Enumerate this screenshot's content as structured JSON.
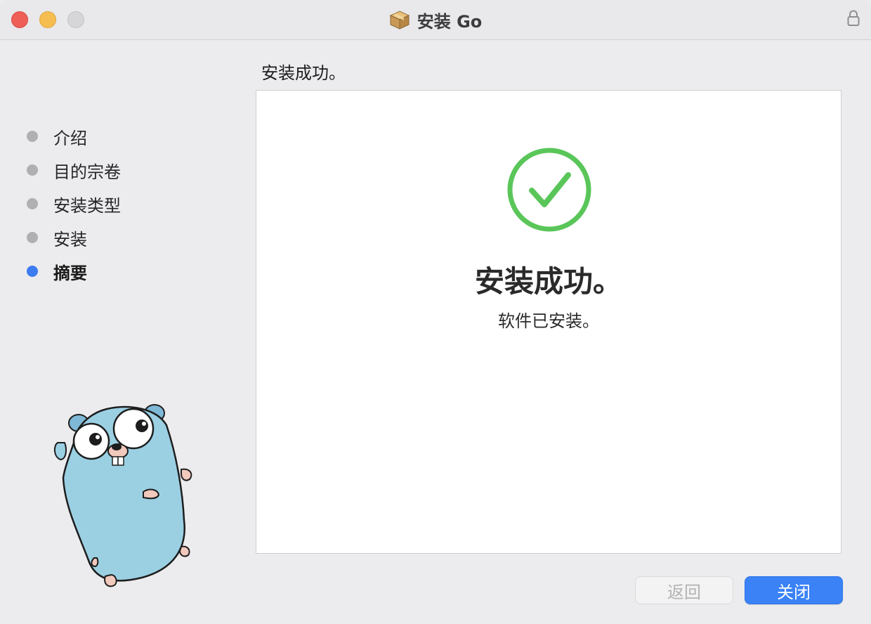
{
  "window": {
    "title": "安装 Go",
    "title_icon": "package-icon",
    "lock_icon": "lock-icon"
  },
  "sidebar": {
    "steps": [
      {
        "label": "介绍",
        "active": false
      },
      {
        "label": "目的宗卷",
        "active": false
      },
      {
        "label": "安装类型",
        "active": false
      },
      {
        "label": "安装",
        "active": false
      },
      {
        "label": "摘要",
        "active": true
      }
    ],
    "active_color": "#3d7cf0",
    "inactive_color": "#b0b0b2"
  },
  "main": {
    "header_status": "安装成功。",
    "success_title": "安装成功。",
    "success_subtitle": "软件已安装。",
    "check_color": "#5ac65a"
  },
  "buttons": {
    "back_label": "返回",
    "close_label": "关闭",
    "back_enabled": false
  },
  "colors": {
    "accent": "#3a82f6",
    "traffic_close": "#ee5f57",
    "traffic_minimize": "#f6be50",
    "traffic_zoom": "#d6d5d7"
  }
}
